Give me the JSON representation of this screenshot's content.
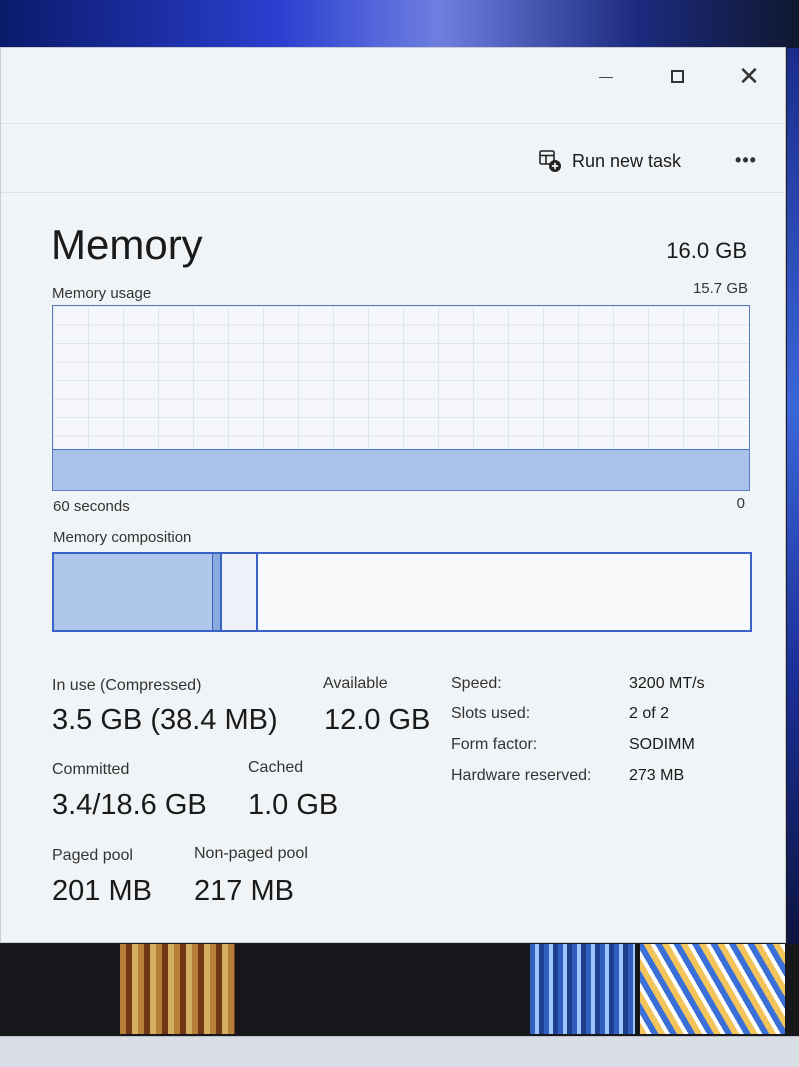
{
  "window": {
    "title": "Memory",
    "total": "16.0 GB",
    "controls": {
      "minimize": "minimize-icon",
      "maximize": "maximize-icon",
      "close": "close-icon"
    }
  },
  "toolbar": {
    "run_new_task": "Run new task",
    "more_label": "•••"
  },
  "usage_graph": {
    "label": "Memory usage",
    "max_label": "15.7 GB",
    "axis_left": "60 seconds",
    "axis_right": "0",
    "in_use_fraction": 0.22,
    "accent": "#4a6fc2",
    "fill_color": "#a9c2e8"
  },
  "composition": {
    "label": "Memory composition",
    "in_use_fraction": 0.229,
    "modified_fraction": 0.012,
    "standby_fraction": 0.052,
    "free_fraction": 0.707
  },
  "stats": {
    "in_use": {
      "label": "In use (Compressed)",
      "value": "3.5 GB (38.4 MB)"
    },
    "available": {
      "label": "Available",
      "value": "12.0 GB"
    },
    "committed": {
      "label": "Committed",
      "value": "3.4/18.6 GB"
    },
    "cached": {
      "label": "Cached",
      "value": "1.0 GB"
    },
    "paged_pool": {
      "label": "Paged pool",
      "value": "201 MB"
    },
    "non_paged_pool": {
      "label": "Non-paged pool",
      "value": "217 MB"
    }
  },
  "specs": {
    "speed": {
      "label": "Speed:",
      "value": "3200 MT/s"
    },
    "slots": {
      "label": "Slots used:",
      "value": "2 of 2"
    },
    "form_factor": {
      "label": "Form factor:",
      "value": "SODIMM"
    },
    "hw_reserved": {
      "label": "Hardware reserved:",
      "value": "273 MB"
    }
  }
}
